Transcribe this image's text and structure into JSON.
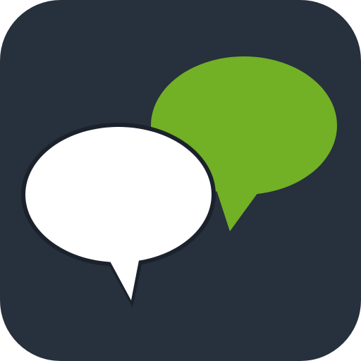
{
  "app_icon": {
    "icon_name": "chat-bubbles-icon",
    "colors": {
      "background": "#27303d",
      "green_bubble": "#72b026",
      "white_bubble": "#ffffff",
      "outline": "#1b222c"
    }
  }
}
